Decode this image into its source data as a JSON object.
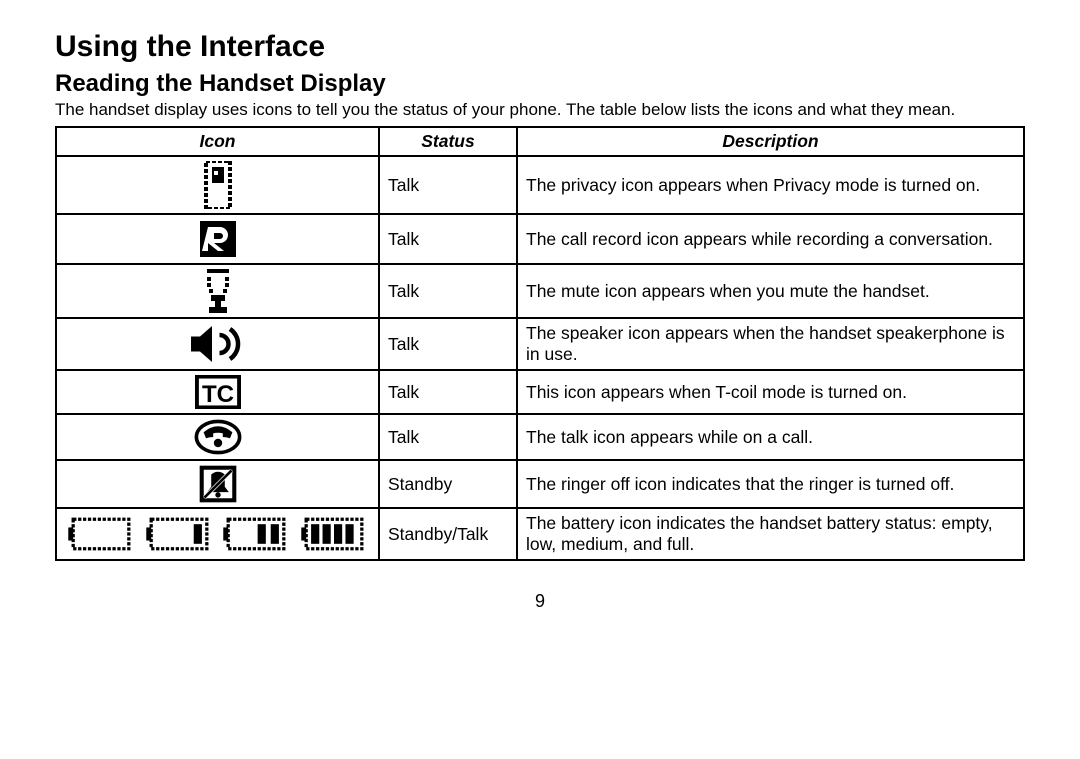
{
  "heading1": "Using the Interface",
  "heading2": "Reading the Handset Display",
  "intro": "The handset display uses icons to tell you the status of your phone. The table below lists the icons and what they mean.",
  "headers": {
    "icon": "Icon",
    "status": "Status",
    "description": "Description"
  },
  "rows": [
    {
      "icon": "privacy-icon",
      "status": "Talk",
      "description": "The privacy icon appears when Privacy mode is turned on."
    },
    {
      "icon": "record-icon",
      "status": "Talk",
      "description": "The call record icon appears while recording a conversation."
    },
    {
      "icon": "mute-icon",
      "status": "Talk",
      "description": "The mute icon appears when you mute the handset."
    },
    {
      "icon": "speaker-icon",
      "status": "Talk",
      "description": "The speaker icon appears when the handset speakerphone is in use."
    },
    {
      "icon": "tcoil-icon",
      "status": "Talk",
      "description": "This icon appears when T-coil mode is turned on."
    },
    {
      "icon": "talk-icon",
      "status": "Talk",
      "description": "The talk icon appears while on a call."
    },
    {
      "icon": "ringer-off-icon",
      "status": "Standby",
      "description": "The ringer off icon indicates that the ringer is turned off."
    },
    {
      "icon": "battery-icons",
      "status": "Standby/Talk",
      "description": "The battery icon indicates the handset battery status: empty, low, medium, and full."
    }
  ],
  "page_number": "9"
}
